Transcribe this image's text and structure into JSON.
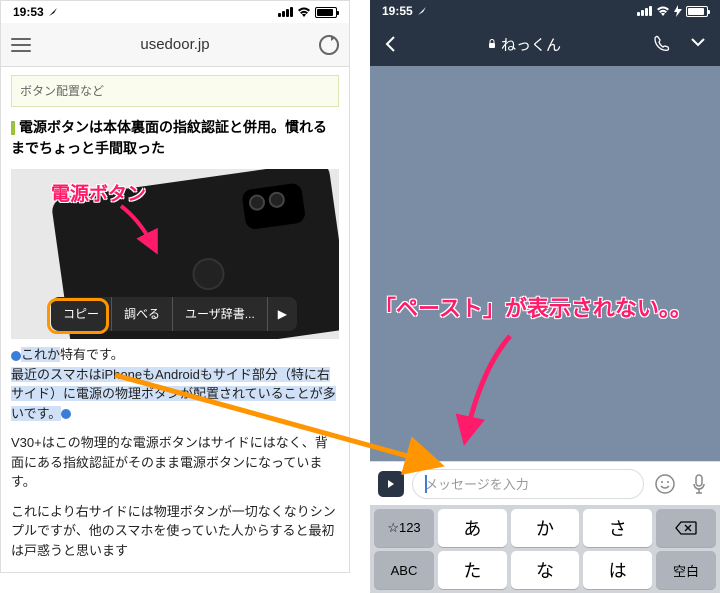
{
  "left": {
    "status": {
      "time": "19:53"
    },
    "url": "usedoor.jp",
    "category": "ボタン配置など",
    "heading": "電源ボタンは本体裏面の指紋認証と併用。慣れるまでちょっと手間取った",
    "photo_annotation": "電源ボタン",
    "bubble": {
      "copy": "コピー",
      "lookup": "調べる",
      "dict": "ユーザ辞書...",
      "more": "▶"
    },
    "selected_before": "これか",
    "selected_text_1": "特有です。",
    "selected_para": "最近のスマホはiPhoneもAndroidもサイド部分（特に右サイド）に電源の物理ボタンが配置されていることが多いです。",
    "para2": "V30+はこの物理的な電源ボタンはサイドにはなく、背面にある指紋認証がそのまま電源ボタンになっています。",
    "para3": "これにより右サイドには物理ボタンが一切なくなりシンプルですが、他のスマホを使っていた人からすると最初は戸惑うと思います"
  },
  "right": {
    "status": {
      "time": "19:55"
    },
    "chat_title": "ねっくん",
    "annotation": "「ペースト」が表示されない。。",
    "input_placeholder": "メッセージを入力",
    "keys": {
      "num": "☆123",
      "a": "あ",
      "ka": "か",
      "sa": "さ",
      "abc": "ABC",
      "ta": "た",
      "na": "な",
      "ha": "は",
      "space": "空白"
    }
  }
}
